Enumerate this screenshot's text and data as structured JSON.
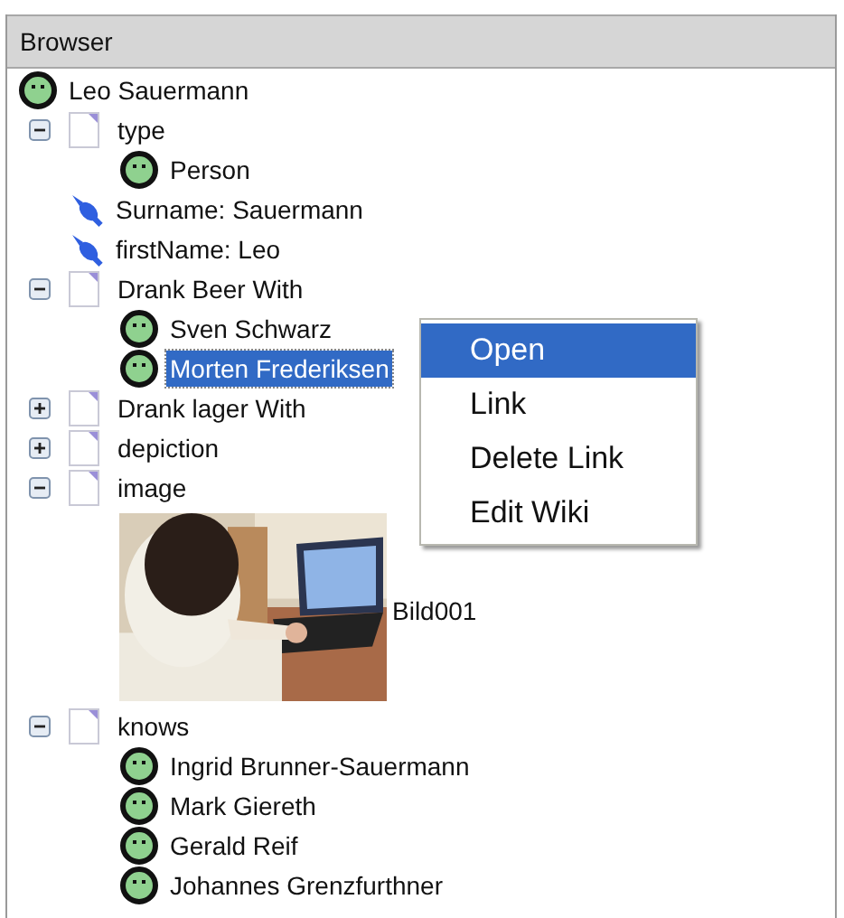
{
  "panel": {
    "title": "Browser"
  },
  "tree": [
    {
      "kind": "person",
      "label": "Leo Sauermann",
      "selected": false,
      "children": [
        {
          "kind": "property",
          "label": "type",
          "expanded": true,
          "selected": false,
          "children": [
            {
              "kind": "person",
              "label": "Person",
              "selected": false
            }
          ]
        },
        {
          "kind": "literal",
          "label": "Surname: Sauermann",
          "selected": false
        },
        {
          "kind": "literal",
          "label": "firstName: Leo",
          "selected": false
        },
        {
          "kind": "property",
          "label": "Drank Beer With",
          "expanded": true,
          "selected": false,
          "children": [
            {
              "kind": "person",
              "label": "Sven Schwarz",
              "selected": false
            },
            {
              "kind": "person",
              "label": "Morten Frederiksen",
              "selected": true
            }
          ]
        },
        {
          "kind": "property",
          "label": "Drank lager With",
          "expanded": false,
          "selected": false
        },
        {
          "kind": "property",
          "label": "depiction",
          "expanded": false,
          "selected": false
        },
        {
          "kind": "property",
          "label": "image",
          "expanded": true,
          "selected": false,
          "children": [
            {
              "caption": "Bild001"
            }
          ]
        },
        {
          "kind": "property",
          "label": "knows",
          "expanded": true,
          "selected": false,
          "children": [
            {
              "kind": "person",
              "label": "Ingrid Brunner-Sauermann",
              "selected": false
            },
            {
              "kind": "person",
              "label": "Mark Giereth",
              "selected": false
            },
            {
              "kind": "person",
              "label": "Gerald Reif",
              "selected": false
            },
            {
              "kind": "person",
              "label": "Johannes Grenzfurthner",
              "selected": false
            }
          ]
        }
      ]
    }
  ],
  "context_menu": [
    {
      "label": "Open",
      "selected": true
    },
    {
      "label": "Link",
      "selected": false
    },
    {
      "label": "Delete Link",
      "selected": false
    },
    {
      "label": "Edit Wiki",
      "selected": false
    }
  ]
}
